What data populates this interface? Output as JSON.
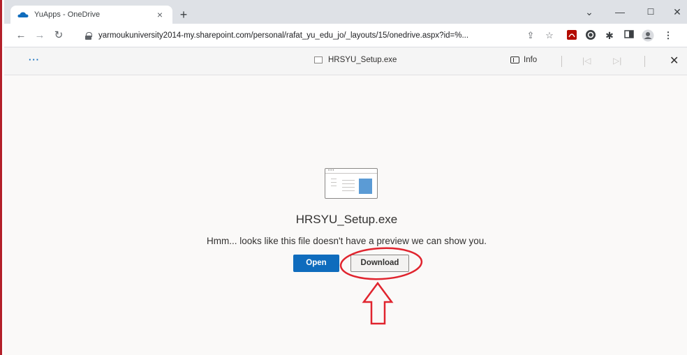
{
  "browser": {
    "tab_title": "YuApps - OneDrive",
    "tab_close": "×",
    "new_tab": "+",
    "url": "yarmoukuniversity2014-my.sharepoint.com/personal/rafat_yu_edu_jo/_layouts/15/onedrive.aspx?id=%...",
    "window_controls": {
      "dropdown": "⌄",
      "minimize": "—",
      "maximize": "☐",
      "close": "✕"
    }
  },
  "viewer": {
    "more_label": "···",
    "file_title": "HRSYU_Setup.exe",
    "info_label": "Info",
    "close_label": "✕"
  },
  "content": {
    "file_name": "HRSYU_Setup.exe",
    "message": "Hmm... looks like this file doesn't have a preview we can show you.",
    "open_label": "Open",
    "download_label": "Download"
  },
  "colors": {
    "brand_blue": "#0f6cbd",
    "annotation_red": "#e0242e",
    "frame_red": "#b3202a"
  },
  "icons": [
    "onedrive-cloud-icon",
    "back-icon",
    "forward-icon",
    "reload-icon",
    "lock-icon",
    "share-icon",
    "bookmark-star-icon",
    "pdf-extension-icon",
    "grammarly-extension-icon",
    "extensions-puzzle-icon",
    "side-panel-icon",
    "profile-icon",
    "browser-menu-icon",
    "file-preview-icon",
    "up-arrow-annotation"
  ]
}
